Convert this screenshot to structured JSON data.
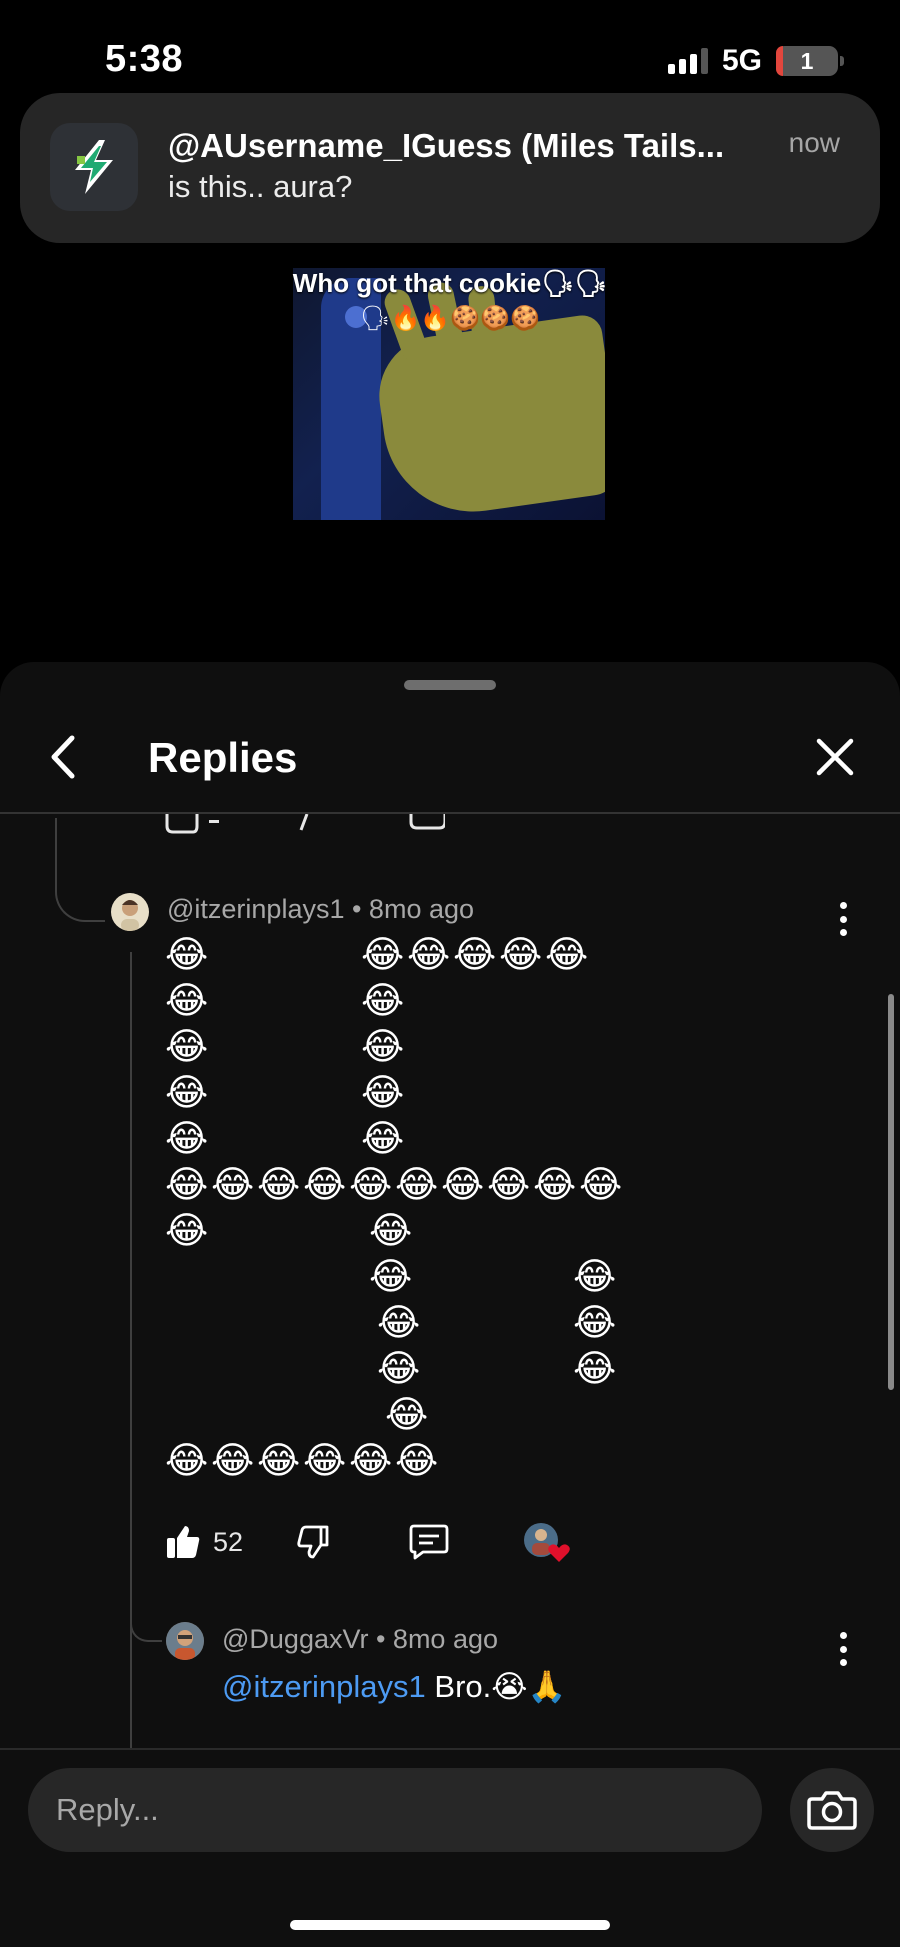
{
  "status_bar": {
    "time": "5:38",
    "network": "5G",
    "battery_level": "1"
  },
  "notification": {
    "icon": "lightning-app-icon",
    "title": "@AUsername_IGuess (Miles Tails...",
    "body": "is this.. aura?",
    "time": "now"
  },
  "video": {
    "caption": "Who got that cookie🗣🗣",
    "caption_emojis": "🗣🔥🔥🍪🍪🍪"
  },
  "sheet": {
    "title": "Replies",
    "back_icon": "chevron-left-icon",
    "close_icon": "close-icon"
  },
  "comments": [
    {
      "handle": "@itzerinplays1",
      "age": "8mo ago",
      "meta": "@itzerinplays1 • 8mo ago",
      "emoji": "😂",
      "likes": "52"
    },
    {
      "handle": "@DuggaxVr",
      "age": "8mo ago",
      "meta": "@DuggaxVr • 8mo ago",
      "mention": "@itzerinplays1",
      "text": " Bro.😭🙏"
    }
  ],
  "reply_bar": {
    "placeholder": "Reply...",
    "camera_icon": "camera-icon"
  },
  "colors": {
    "background": "#000000",
    "sheet": "#0f0f0f",
    "mention": "#4d9bf3",
    "heart": "#e0102b"
  }
}
